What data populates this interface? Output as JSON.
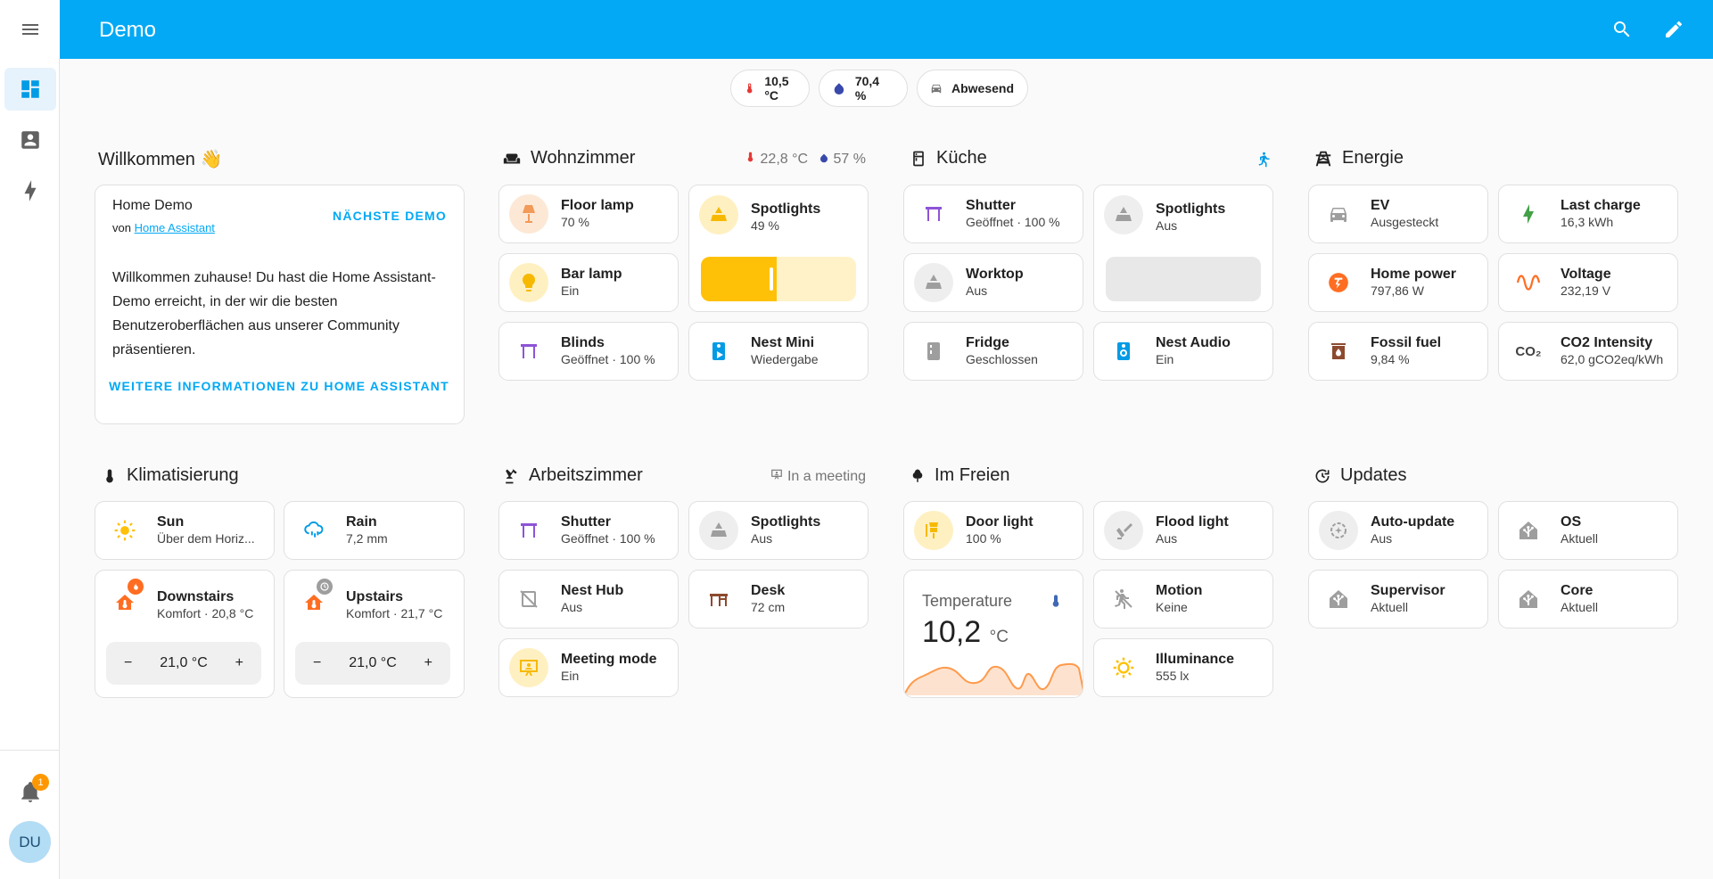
{
  "app": {
    "title": "Demo"
  },
  "sidebar": {
    "notification_count": "1",
    "avatar_initials": "DU"
  },
  "badges": [
    {
      "value": "10,5 °C",
      "icon": "thermometer-icon",
      "color": "#e53935"
    },
    {
      "value": "70,4 %",
      "icon": "water-percent-icon",
      "color": "#3949ab"
    },
    {
      "value": "Abwesend",
      "icon": "car-icon",
      "color": "#757575"
    }
  ],
  "welcome": {
    "heading": "Willkommen 👋",
    "title": "Home Demo",
    "by_prefix": "von",
    "by_link": "Home Assistant",
    "next_demo": "NÄCHSTE DEMO",
    "body": "Willkommen zuhause! Du hast die Home Assistant-Demo erreicht, in der wir die besten Benutzeroberflächen aus unserer Community präsentieren.",
    "more_info": "WEITERE INFORMATIONEN ZU HOME ASSISTANT"
  },
  "wohnzimmer": {
    "heading": "Wohnzimmer",
    "temp": "22,8 °C",
    "humidity": "57 %",
    "floor_lamp": {
      "name": "Floor lamp",
      "state": "70 %"
    },
    "bar_lamp": {
      "name": "Bar lamp",
      "state": "Ein"
    },
    "blinds": {
      "name": "Blinds",
      "state": "Geöffnet · 100 %"
    },
    "spotlights": {
      "name": "Spotlights",
      "state": "49 %",
      "brightness_percent": 49
    },
    "nest_mini": {
      "name": "Nest Mini",
      "state": "Wiedergabe"
    }
  },
  "kueche": {
    "heading": "Küche",
    "shutter": {
      "name": "Shutter",
      "state": "Geöffnet · 100 %"
    },
    "worktop": {
      "name": "Worktop",
      "state": "Aus"
    },
    "fridge": {
      "name": "Fridge",
      "state": "Geschlossen"
    },
    "spotlights": {
      "name": "Spotlights",
      "state": "Aus"
    },
    "nest_audio": {
      "name": "Nest Audio",
      "state": "Ein"
    }
  },
  "energie": {
    "heading": "Energie",
    "ev": {
      "name": "EV",
      "state": "Ausgesteckt"
    },
    "last_charge": {
      "name": "Last charge",
      "state": "16,3 kWh"
    },
    "home_power": {
      "name": "Home power",
      "state": "797,86 W"
    },
    "voltage": {
      "name": "Voltage",
      "state": "232,19 V"
    },
    "fossil_fuel": {
      "name": "Fossil fuel",
      "state": "9,84 %"
    },
    "co2": {
      "name": "CO2 Intensity",
      "state": "62,0 gCO2eq/kWh",
      "icon_text": "CO₂"
    }
  },
  "klima": {
    "heading": "Klimatisierung",
    "sun": {
      "name": "Sun",
      "state": "Über dem Horiz..."
    },
    "rain": {
      "name": "Rain",
      "state": "7,2 mm"
    },
    "downstairs": {
      "name": "Downstairs",
      "state": "Komfort · 20,8 °C",
      "target": "21,0 °C"
    },
    "upstairs": {
      "name": "Upstairs",
      "state": "Komfort · 21,7 °C",
      "target": "21,0 °C"
    },
    "minus": "−",
    "plus": "+"
  },
  "arbeitszimmer": {
    "heading": "Arbeitszimmer",
    "meta": "In a meeting",
    "shutter": {
      "name": "Shutter",
      "state": "Geöffnet · 100 %"
    },
    "nest_hub": {
      "name": "Nest Hub",
      "state": "Aus"
    },
    "meeting_mode": {
      "name": "Meeting mode",
      "state": "Ein"
    },
    "spotlights": {
      "name": "Spotlights",
      "state": "Aus"
    },
    "desk": {
      "name": "Desk",
      "state": "72 cm"
    }
  },
  "freien": {
    "heading": "Im Freien",
    "door_light": {
      "name": "Door light",
      "state": "100 %"
    },
    "temperature": {
      "name": "Temperature",
      "value": "10,2",
      "unit": "°C"
    },
    "flood_light": {
      "name": "Flood light",
      "state": "Aus"
    },
    "motion": {
      "name": "Motion",
      "state": "Keine"
    },
    "illuminance": {
      "name": "Illuminance",
      "state": "555 lx"
    }
  },
  "updates": {
    "heading": "Updates",
    "auto_update": {
      "name": "Auto-update",
      "state": "Aus"
    },
    "os": {
      "name": "OS",
      "state": "Aktuell"
    },
    "supervisor": {
      "name": "Supervisor",
      "state": "Aktuell"
    },
    "core": {
      "name": "Core",
      "state": "Aktuell"
    }
  }
}
